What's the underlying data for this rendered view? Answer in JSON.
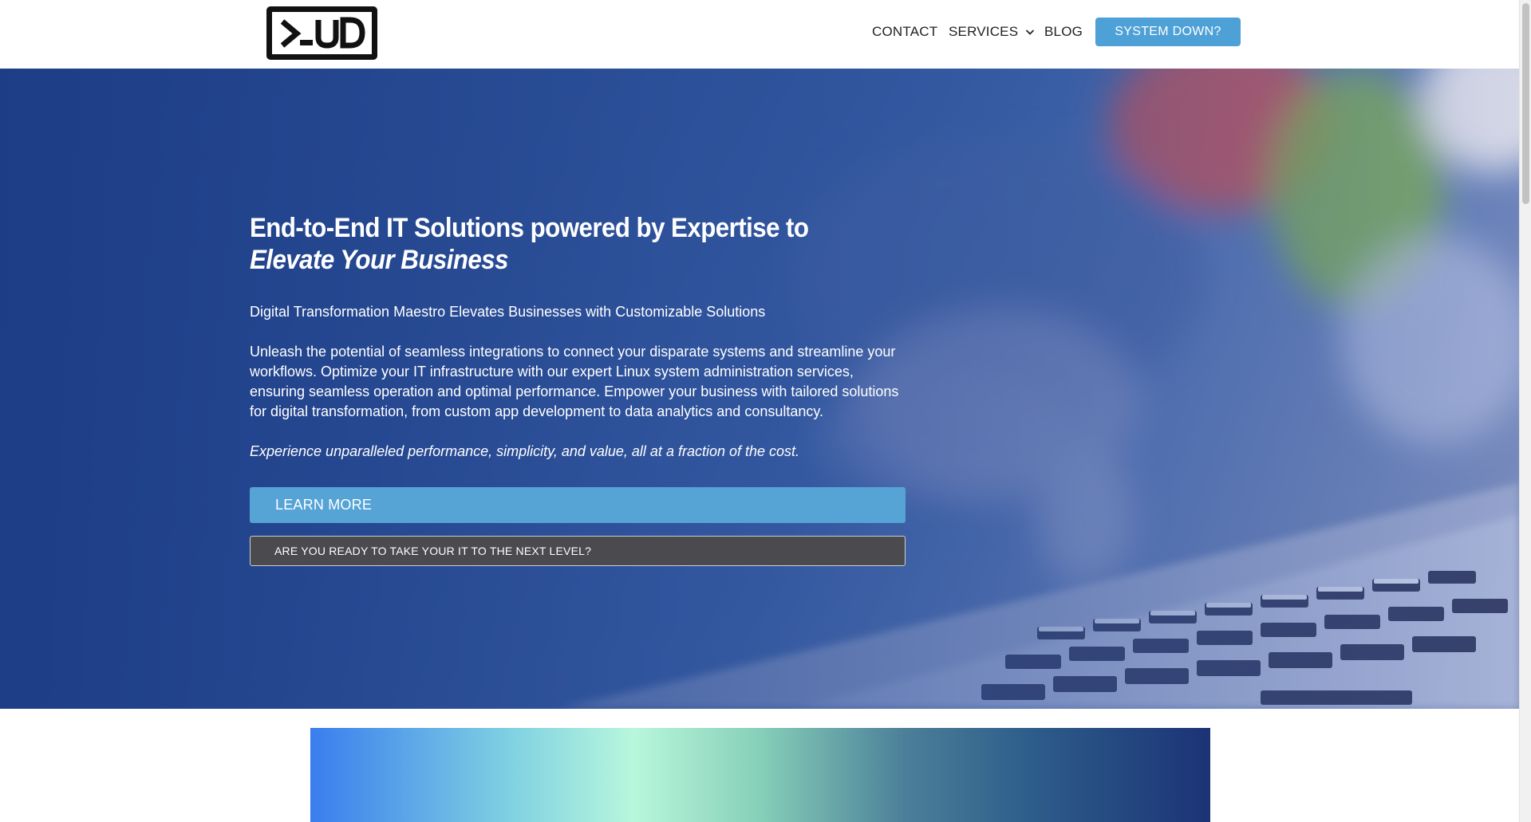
{
  "header": {
    "logo_text": ">_UD",
    "nav": {
      "contact": "CONTACT",
      "services": "SERVICES",
      "blog": "BLOG"
    },
    "cta_label": "SYSTEM DOWN?"
  },
  "hero": {
    "headline_plain": "End-to-End IT Solutions powered by Expertise to ",
    "headline_emphasis": "Elevate Your Business",
    "subheading": "Digital Transformation Maestro Elevates Businesses with Customizable Solutions",
    "body": "Unleash the potential of seamless integrations to connect your disparate systems and streamline your workflows. Optimize your IT infrastructure with our expert Linux system administration services, ensuring seamless operation and optimal performance. Empower your business with tailored solutions for digital transformation, from custom app development to data analytics and consultancy.",
    "tagline": "Experience unparalleled performance, simplicity, and value, all at a fraction of the cost.",
    "learn_more_label": "LEARN MORE",
    "ready_label": "ARE YOU READY TO TAKE YOUR IT TO THE NEXT LEVEL?"
  },
  "icons": {
    "chevron": "chevron-down-icon",
    "hero_image": "laptop-keyboard-photo"
  },
  "colors": {
    "accent": "#4ea1d6",
    "hero_overlay": "#2a4f98",
    "secondary_button": "#4a4a4f",
    "logo": "#111111"
  }
}
